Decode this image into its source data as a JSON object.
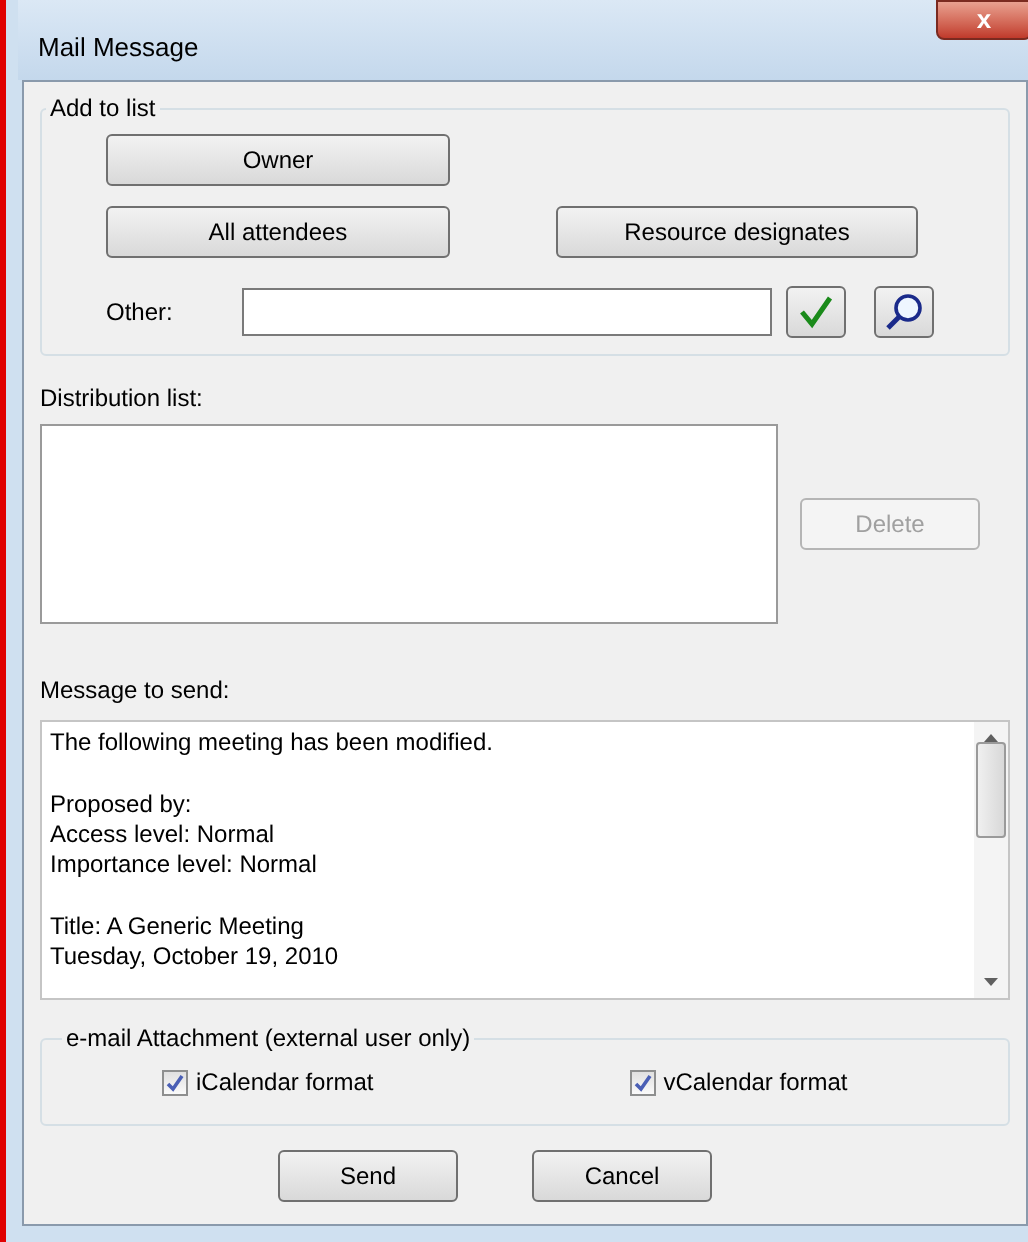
{
  "window": {
    "title": "Mail Message",
    "close": "x"
  },
  "add_to_list": {
    "title": "Add to list",
    "buttons": [
      {
        "label": "Owner"
      },
      {
        "label": "All attendees"
      },
      {
        "label": "Resource designates"
      }
    ],
    "other": {
      "label": "Other:"
    }
  },
  "distribution_list": {
    "label": "Distribution list:",
    "delete": {
      "label": "Delete",
      "disabled": true
    }
  },
  "message": {
    "label": "Message to send:",
    "paragraphs": [
      [
        "The following meeting has been modified."
      ],
      [
        "Proposed by:",
        "Access level: Normal",
        "Importance level: Normal"
      ],
      [
        "Title: A Generic Meeting",
        "Tuesday, October 19, 2010"
      ]
    ]
  },
  "attachment": {
    "title": "e-mail Attachment (external user only)",
    "options": [
      {
        "label": "iCalendar format",
        "checked": true
      },
      {
        "label": "vCalendar format",
        "checked": true
      }
    ]
  },
  "actions": [
    {
      "label": "Send"
    },
    {
      "label": "Cancel"
    }
  ]
}
